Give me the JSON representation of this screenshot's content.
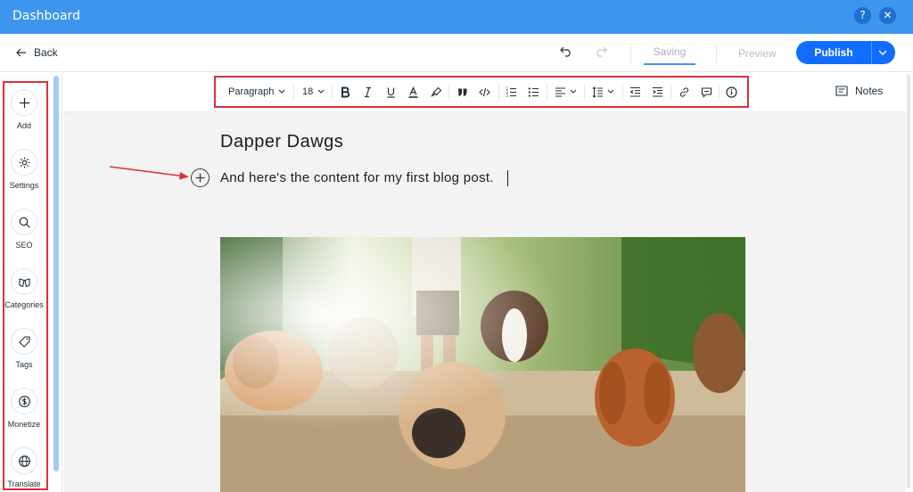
{
  "window": {
    "title": "Dashboard",
    "help_icon": "?",
    "close_icon": "✕"
  },
  "topbar": {
    "back_label": "Back",
    "saving_label": "Saving",
    "preview_label": "Preview",
    "publish_label": "Publish"
  },
  "sidebar": {
    "items": [
      {
        "label": "Add",
        "icon": "plus-icon"
      },
      {
        "label": "Settings",
        "icon": "gear-icon"
      },
      {
        "label": "SEO",
        "icon": "search-icon"
      },
      {
        "label": "Categories",
        "icon": "categories-icon"
      },
      {
        "label": "Tags",
        "icon": "tag-icon"
      },
      {
        "label": "Monetize",
        "icon": "dollar-icon"
      },
      {
        "label": "Translate",
        "icon": "globe-icon"
      }
    ]
  },
  "toolbar": {
    "paragraph_label": "Paragraph",
    "font_size": "18",
    "notes_label": "Notes"
  },
  "post": {
    "title": "Dapper Dawgs",
    "body": "And here's the content for my first blog post."
  },
  "colors": {
    "titlebar": "#3d95ee",
    "publish": "#116dff",
    "highlight_box": "#d8313a",
    "canvas": "#f2f3f2"
  }
}
